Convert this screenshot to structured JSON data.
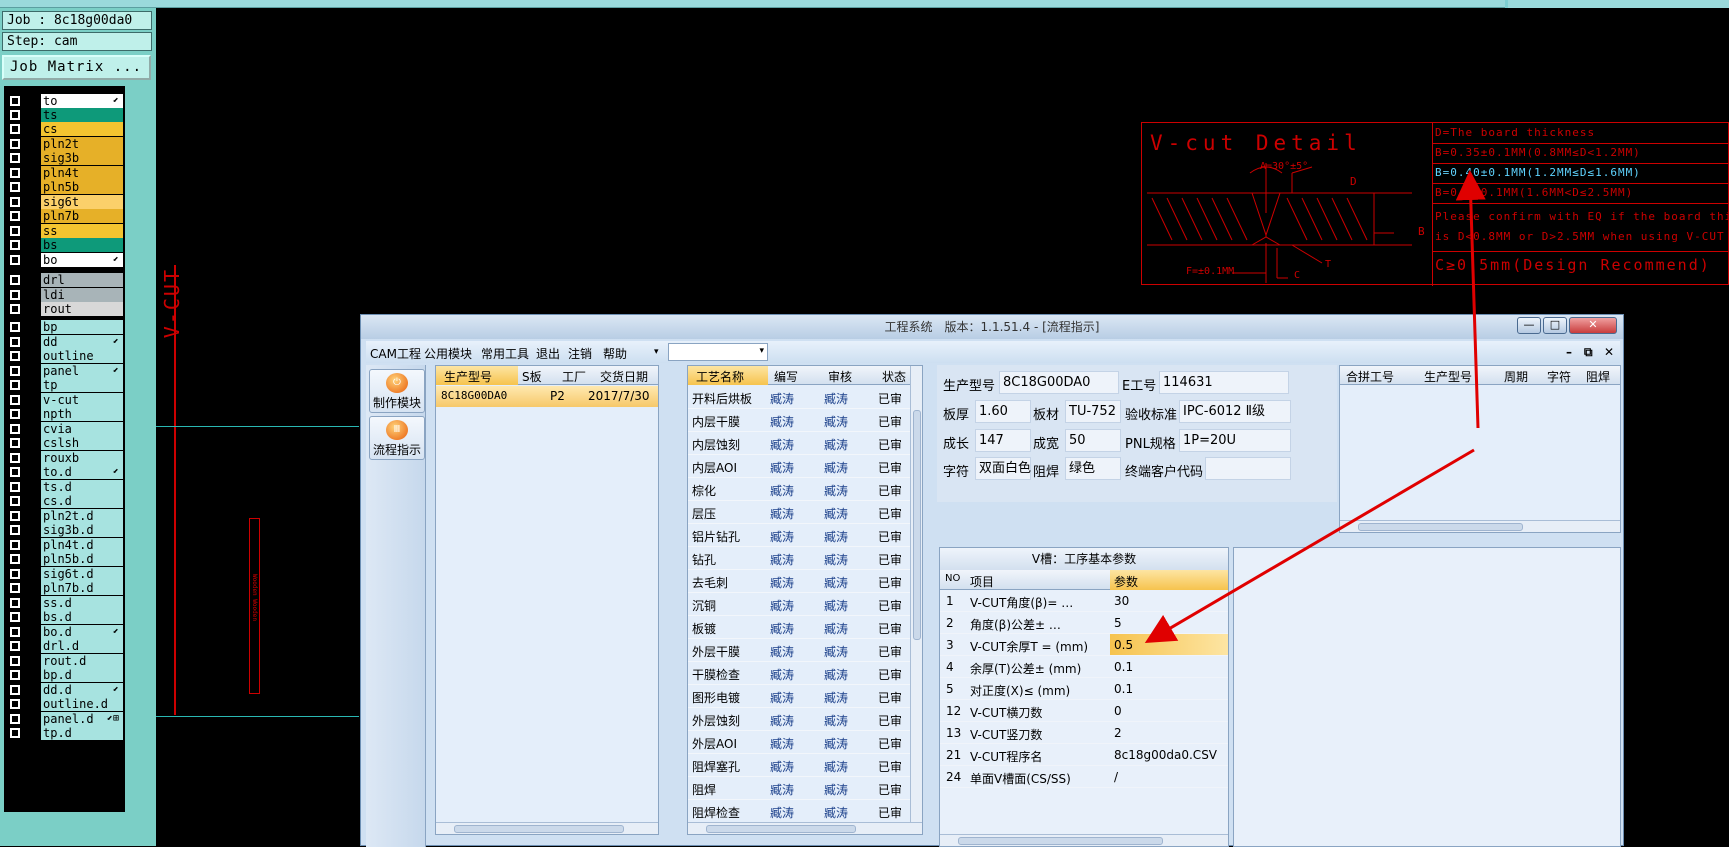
{
  "job_panel": {
    "job": "Job : 8c18g00da0",
    "step": "Step: cam",
    "job_matrix": "Job Matrix ..."
  },
  "layers": [
    {
      "name": "to",
      "color": "#ffffff",
      "mark": "⬋"
    },
    {
      "name": "ts",
      "color": "#0e9a7a",
      "mark": ""
    },
    {
      "name": "cs",
      "color": "#f4c430",
      "mark": ""
    },
    {
      "name": "pln2t",
      "color": "#e6b028",
      "mark": ""
    },
    {
      "name": "sig3b",
      "color": "#e6b028",
      "mark": ""
    },
    {
      "name": "pln4t",
      "color": "#e6b028",
      "mark": ""
    },
    {
      "name": "pln5b",
      "color": "#e6b028",
      "mark": ""
    },
    {
      "name": "sig6t",
      "color": "#fbd06a",
      "mark": ""
    },
    {
      "name": "pln7b",
      "color": "#e6b028",
      "mark": ""
    },
    {
      "name": "ss",
      "color": "#f4c430",
      "mark": ""
    },
    {
      "name": "bs",
      "color": "#0e9a7a",
      "mark": ""
    },
    {
      "name": "bo",
      "color": "#ffffff",
      "mark": "⬋"
    },
    {
      "name": "drl",
      "color": "#a8b4b8",
      "mark": ""
    },
    {
      "name": "ldi",
      "color": "#a8b4b8",
      "mark": ""
    },
    {
      "name": "rout",
      "color": "#d8d8d8",
      "mark": ""
    },
    {
      "name": "bp",
      "color": "#a7e3e0",
      "mark": ""
    },
    {
      "name": "dd",
      "color": "#a7e3e0",
      "mark": "⬋"
    },
    {
      "name": "outline",
      "color": "#a7e3e0",
      "mark": ""
    },
    {
      "name": "panel",
      "color": "#a7e3e0",
      "mark": "⬋"
    },
    {
      "name": "tp",
      "color": "#a7e3e0",
      "mark": ""
    },
    {
      "name": "v-cut",
      "color": "#a7e3e0",
      "mark": ""
    },
    {
      "name": "npth",
      "color": "#a7e3e0",
      "mark": ""
    },
    {
      "name": "cvia",
      "color": "#a7e3e0",
      "mark": ""
    },
    {
      "name": "cslsh",
      "color": "#a7e3e0",
      "mark": ""
    },
    {
      "name": "rouxb",
      "color": "#a7e3e0",
      "mark": ""
    },
    {
      "name": "to.d",
      "color": "#a7e3e0",
      "mark": "⬋"
    },
    {
      "name": "ts.d",
      "color": "#a7e3e0",
      "mark": ""
    },
    {
      "name": "cs.d",
      "color": "#a7e3e0",
      "mark": ""
    },
    {
      "name": "pln2t.d",
      "color": "#a7e3e0",
      "mark": ""
    },
    {
      "name": "sig3b.d",
      "color": "#a7e3e0",
      "mark": ""
    },
    {
      "name": "pln4t.d",
      "color": "#a7e3e0",
      "mark": ""
    },
    {
      "name": "pln5b.d",
      "color": "#a7e3e0",
      "mark": ""
    },
    {
      "name": "sig6t.d",
      "color": "#a7e3e0",
      "mark": ""
    },
    {
      "name": "pln7b.d",
      "color": "#a7e3e0",
      "mark": ""
    },
    {
      "name": "ss.d",
      "color": "#a7e3e0",
      "mark": ""
    },
    {
      "name": "bs.d",
      "color": "#a7e3e0",
      "mark": ""
    },
    {
      "name": "bo.d",
      "color": "#a7e3e0",
      "mark": "⬋"
    },
    {
      "name": "drl.d",
      "color": "#a7e3e0",
      "mark": ""
    },
    {
      "name": "rout.d",
      "color": "#a7e3e0",
      "mark": ""
    },
    {
      "name": "bp.d",
      "color": "#a7e3e0",
      "mark": ""
    },
    {
      "name": "dd.d",
      "color": "#a7e3e0",
      "mark": "⬋"
    },
    {
      "name": "outline.d",
      "color": "#a7e3e0",
      "mark": ""
    },
    {
      "name": "panel.d",
      "color": "#a7e3e0",
      "mark": "⬋⊞"
    },
    {
      "name": "tp.d",
      "color": "#a7e3e0",
      "mark": ""
    }
  ],
  "canvas": {
    "vcut_label": "V-CUT",
    "small_label": "Wooden Wooden"
  },
  "vcut_detail": {
    "title": "V-cut Detail",
    "angle": "A=30°±5°",
    "d": "D",
    "b": "B",
    "f": "F=±0.1MM",
    "t": "T",
    "c": "C",
    "lines": [
      "D=The board thickness",
      "B=0.35±0.1MM(0.8MM≤D<1.2MM)",
      "B=0.40±0.1MM(1.2MM≤D≤1.6MM)",
      "B=0.5±0.1MM(1.6MM<D≤2.5MM)",
      "Please confirm with EQ if the board thickness",
      "is D<0.8MM or D>2.5MM when using V-CUT"
    ],
    "rec": "C≥0.5mm(Design Recommend)"
  },
  "window": {
    "title": "工程系统　版本：1.1.51.4 - [流程指示]",
    "menu": [
      "CAM工程",
      "公用模块",
      "常用工具",
      "退出",
      "注销",
      "帮助"
    ],
    "sidebar": [
      "制作模块",
      "流程指示"
    ],
    "g1": {
      "headers": [
        "生产型号",
        "S板",
        "工厂",
        "交货日期"
      ],
      "row": [
        "8C18G00DA0",
        "P2",
        "2017/7/30"
      ]
    },
    "g2": {
      "headers": [
        "工艺名称",
        "编写",
        "审核",
        "状态"
      ],
      "rows": [
        [
          "开料后烘板",
          "臧涛",
          "臧涛",
          "已审"
        ],
        [
          "内层干膜",
          "臧涛",
          "臧涛",
          "已审"
        ],
        [
          "内层蚀刻",
          "臧涛",
          "臧涛",
          "已审"
        ],
        [
          "内层AOI",
          "臧涛",
          "臧涛",
          "已审"
        ],
        [
          "棕化",
          "臧涛",
          "臧涛",
          "已审"
        ],
        [
          "层压",
          "臧涛",
          "臧涛",
          "已审"
        ],
        [
          "铝片钻孔",
          "臧涛",
          "臧涛",
          "已审"
        ],
        [
          "钻孔",
          "臧涛",
          "臧涛",
          "已审"
        ],
        [
          "去毛刺",
          "臧涛",
          "臧涛",
          "已审"
        ],
        [
          "沉铜",
          "臧涛",
          "臧涛",
          "已审"
        ],
        [
          "板镀",
          "臧涛",
          "臧涛",
          "已审"
        ],
        [
          "外层干膜",
          "臧涛",
          "臧涛",
          "已审"
        ],
        [
          "干膜检查",
          "臧涛",
          "臧涛",
          "已审"
        ],
        [
          "图形电镀",
          "臧涛",
          "臧涛",
          "已审"
        ],
        [
          "外层蚀刻",
          "臧涛",
          "臧涛",
          "已审"
        ],
        [
          "外层AOI",
          "臧涛",
          "臧涛",
          "已审"
        ],
        [
          "阻焊塞孔",
          "臧涛",
          "臧涛",
          "已审"
        ],
        [
          "阻焊",
          "臧涛",
          "臧涛",
          "已审"
        ],
        [
          "阻焊检查",
          "臧涛",
          "臧涛",
          "已审"
        ]
      ]
    },
    "info": {
      "r1": [
        [
          "生产型号",
          "8C18G00DA0"
        ],
        [
          "E工号",
          "114631"
        ]
      ],
      "r2": [
        [
          "板厚",
          "1.60"
        ],
        [
          "板材",
          "TU-752"
        ],
        [
          "验收标准",
          "IPC-6012 Ⅱ级"
        ]
      ],
      "r3": [
        [
          "成长",
          "147"
        ],
        [
          "成宽",
          "50"
        ],
        [
          "PNL规格",
          "1P=20U"
        ]
      ],
      "r4": [
        [
          "字符",
          "双面白色"
        ],
        [
          "阻焊",
          "绿色"
        ],
        [
          "终端客户代码",
          ""
        ]
      ]
    },
    "g3": {
      "headers": [
        "合拼工号",
        "生产型号",
        "周期",
        "字符",
        "阻焊"
      ]
    },
    "vparam": {
      "title": "V槽：工序基本参数",
      "headers": [
        "NO",
        "项目",
        "参数"
      ],
      "rows": [
        [
          "1",
          "V-CUT角度(β)= …",
          "30"
        ],
        [
          "2",
          "角度(β)公差± …",
          "5"
        ],
        [
          "3",
          "V-CUT余厚T = (mm)",
          "0.5"
        ],
        [
          "4",
          "余厚(T)公差± (mm)",
          "0.1"
        ],
        [
          "5",
          "对正度(X)≤ (mm)",
          "0.1"
        ],
        [
          "12",
          "V-CUT横刀数",
          "0"
        ],
        [
          "13",
          "V-CUT竖刀数",
          "2"
        ],
        [
          "21",
          "V-CUT程序名",
          "8c18g00da0.CSV"
        ],
        [
          "24",
          "单面V槽面(CS/SS)",
          "/"
        ]
      ]
    }
  },
  "colors": {
    "highlight": "#f6c34e",
    "annotation": "#e00000"
  }
}
